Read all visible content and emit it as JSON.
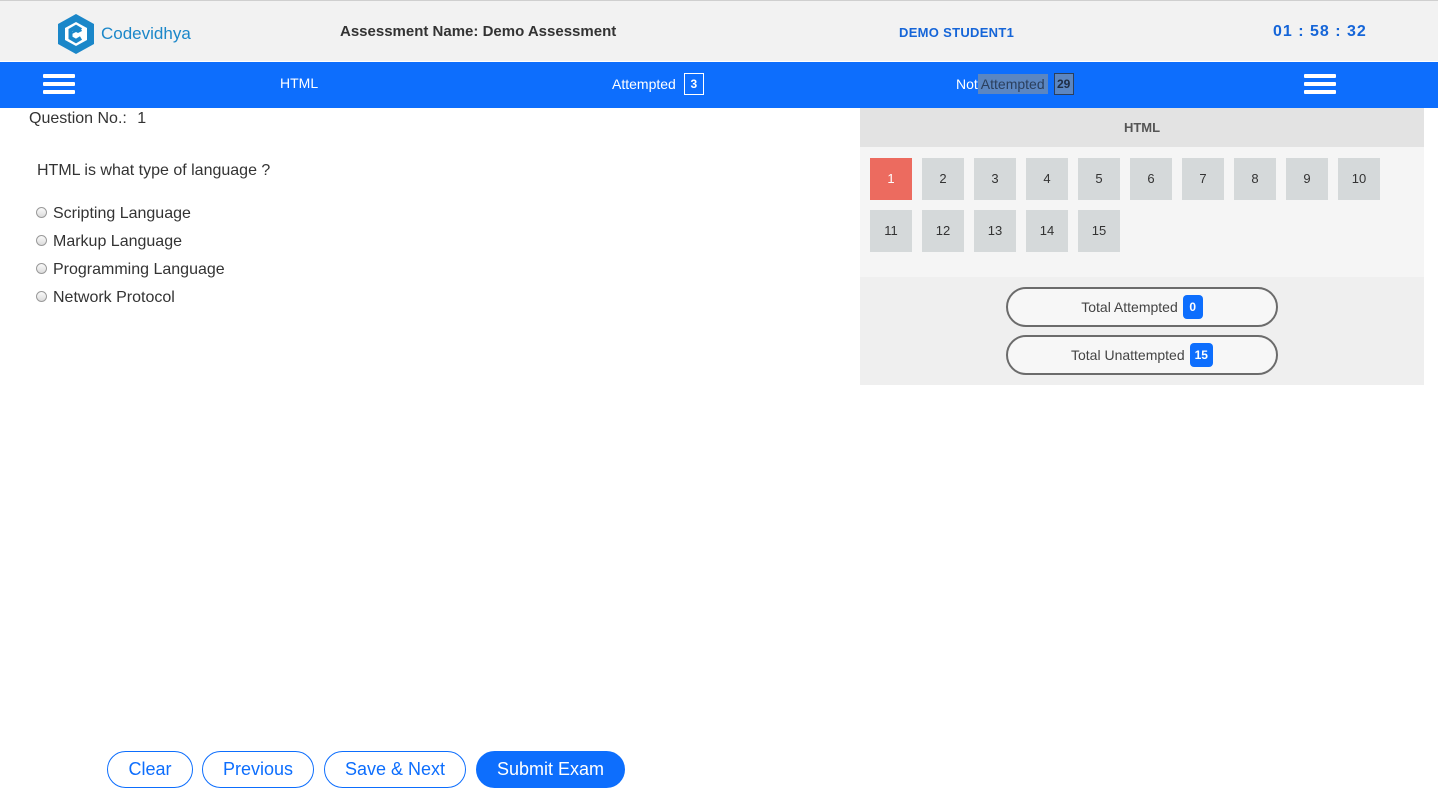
{
  "header": {
    "logo_text": "Codevidhya",
    "assessment_name": "Assessment Name: Demo Assessment",
    "student_name": "DEMO STUDENT1",
    "timer": "01 : 58 : 32"
  },
  "nav": {
    "subject": "HTML",
    "attempted_label": "Attempted",
    "attempted_count": "3",
    "not_label": "Not",
    "not_attempted_label": "Attempted",
    "not_attempted_count": "29"
  },
  "question": {
    "number_label": "Question No.:",
    "number": "1",
    "text": "HTML is what type of language ?",
    "options": [
      "Scripting Language",
      "Markup Language",
      "Programming Language",
      "Network Protocol"
    ]
  },
  "panel": {
    "section_title": "HTML",
    "questions": [
      "1",
      "2",
      "3",
      "4",
      "5",
      "6",
      "7",
      "8",
      "9",
      "10",
      "11",
      "12",
      "13",
      "14",
      "15"
    ],
    "current": "1",
    "total_attempted_label": "Total Attempted",
    "total_attempted": "0",
    "total_unattempted_label": "Total Unattempted",
    "total_unattempted": "15"
  },
  "footer": {
    "clear": "Clear",
    "previous": "Previous",
    "save_next": "Save & Next",
    "submit": "Submit Exam"
  },
  "colors": {
    "primary": "#0d6efd",
    "current_question": "#ec6b5f",
    "question_button": "#d5d9da"
  }
}
